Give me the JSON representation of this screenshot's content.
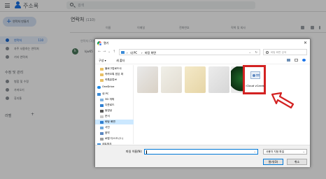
{
  "app": {
    "title": "주소록",
    "search_placeholder": "검색",
    "create_label": "연락처 만들기",
    "nav": [
      {
        "label": "연락처",
        "count": "110",
        "active": true
      },
      {
        "label": "자주 사용하는 연락처",
        "count": "",
        "active": false
      },
      {
        "label": "기타 연락처",
        "count": "",
        "active": false
      }
    ],
    "section_title": "수정 및 관리",
    "manage": [
      "병합 및 수정",
      "가져오기",
      "휴지통"
    ],
    "labels_title": "라벨",
    "main_title": "연락처",
    "main_count": "(110)",
    "columns": [
      "이름",
      "이메일",
      "전화번호",
      "직책 및 회사"
    ],
    "row_label": "연락처 (1명)",
    "row_avatar_letter": "k",
    "row_name": "kjw65"
  },
  "dialog": {
    "title": "열기",
    "address": [
      "내 PC",
      "바탕 화면"
    ],
    "search_placeholder": "바탕 화면 검색",
    "toolbar": {
      "organize": "구성 ▾",
      "new_folder": "새 폴더"
    },
    "tree": [
      {
        "label": "블로그업로드사",
        "icon": "folder-icon",
        "indent": 1
      },
      {
        "label": "카카오톡 받은 파",
        "icon": "folder-icon",
        "indent": 1
      },
      {
        "label": "카톡유튜브",
        "icon": "folder-icon",
        "indent": 1
      },
      {
        "label": "OneDrive",
        "icon": "cloud-icon",
        "indent": 0
      },
      {
        "label": "내 PC",
        "icon": "pc-icon",
        "indent": 0
      },
      {
        "label": "3D 개체",
        "icon": "3d-icon",
        "indent": 1
      },
      {
        "label": "다운로드",
        "icon": "download-icon",
        "indent": 1
      },
      {
        "label": "동영상",
        "icon": "video-icon",
        "indent": 1
      },
      {
        "label": "문서",
        "icon": "document-icon",
        "indent": 1
      },
      {
        "label": "바탕 화면",
        "icon": "desktop-icon",
        "indent": 1,
        "selected": true
      },
      {
        "label": "사진",
        "icon": "picture-icon",
        "indent": 1
      },
      {
        "label": "음악",
        "icon": "music-icon",
        "indent": 1
      },
      {
        "label": "로컬 디스크 (C:)",
        "icon": "disk-icon",
        "indent": 1
      },
      {
        "label": "네트워크",
        "icon": "network-icon",
        "indent": 0
      }
    ],
    "selected_file": "iCloud vCards",
    "filename_label": "파일 이름(N):",
    "filename_value": "",
    "filetype": "사용자 지정 파일",
    "open_label": "열기(O)",
    "cancel_label": "취소"
  },
  "colors": {
    "accent": "#1a73e8",
    "highlight_box": "#d32222",
    "arrow": "#d32222",
    "tree_selected": "#cce8ff"
  }
}
